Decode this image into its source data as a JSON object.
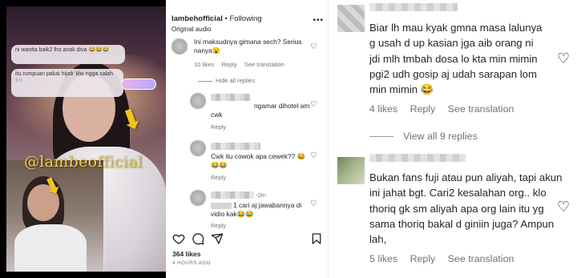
{
  "video": {
    "bubble1_text": "ni wanita baik2 lho anak diva 😂😂😂",
    "bubble2_text": "itu rumpuan pakai hijab' klw ngga salah",
    "bubble2_time": "3 h",
    "watermark": "@lambeofficial",
    "arrow_glyph": "⬇"
  },
  "post": {
    "username": "lambehofficial",
    "following": "• Following",
    "audio": "Original audio",
    "more_icon": "•••",
    "likes": "364 likes",
    "time": "4 HOURS AGO"
  },
  "middle_comments": [
    {
      "text": "Ini maksudnya gimana sech? Serius nanya😮",
      "likes": "10 likes",
      "reply": "Reply",
      "see_translation": "See translation"
    },
    {
      "text": "ngamar dihotel am cwk",
      "reply": "Reply"
    },
    {
      "text": "Cwk itu cowok apa cewek?? 😂😂😂",
      "reply": "Reply"
    },
    {
      "time": "-2m",
      "text": "1 cari aj jawabannya di vidio kak😂😂",
      "reply": "Reply"
    }
  ],
  "hide_replies": "Hide all replies",
  "right_comments": [
    {
      "text": "Biar lh mau kyak gmna masa lalunya g usah d up kasian jga aib orang ni jdi mlh tmbah dosa lo kta min mimin pgi2 udh gosip aj udah sarapan lom min mimin 😂",
      "likes": "4 likes",
      "reply": "Reply",
      "see_translation": "See translation"
    },
    {
      "text": "Bukan fans fuji atau pun aliyah, tapi akun ini jahat bgt. Cari2 kesalahan org.. klo thoriq gk sm aliyah apa org lain itu yg sama thoriq bakal d giniin juga? Ampun lah,",
      "likes": "5 likes",
      "reply": "Reply",
      "see_translation": "See translation"
    }
  ],
  "view_replies": "View all 9 replies",
  "icons": {
    "heart": "♡",
    "like": "heart-icon",
    "comment": "comment-icon",
    "share": "share-icon",
    "save": "bookmark-icon"
  },
  "colors": {
    "text": "#262626",
    "meta": "#737373",
    "watermark": "#f4d046",
    "arrow": "#f2c419"
  }
}
